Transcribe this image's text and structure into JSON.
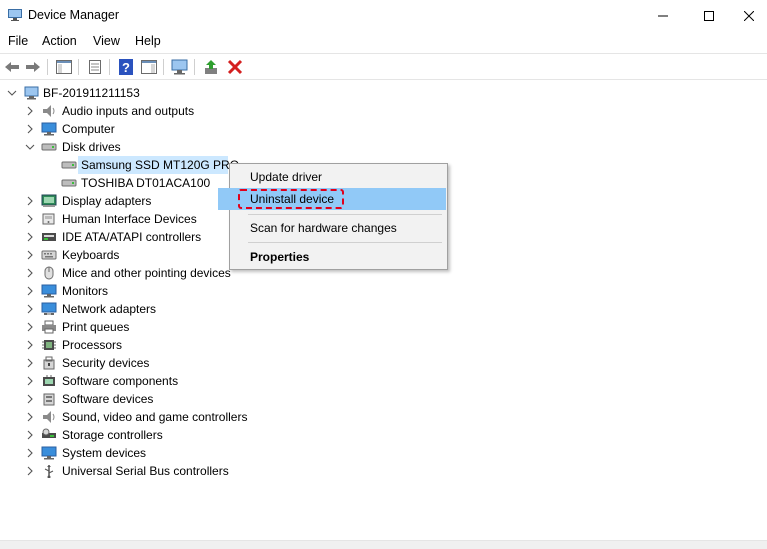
{
  "window": {
    "title": "Device Manager",
    "controls": {
      "minimize": "—",
      "maximize": "☐",
      "close": "✕"
    }
  },
  "menu": [
    "File",
    "Action",
    "View",
    "Help"
  ],
  "toolbar": {
    "buttons": [
      "back-icon",
      "forward-icon",
      "show-hide-console-tree-icon",
      "properties-icon",
      "help-icon",
      "show-action-pane-icon",
      "scan-hardware-icon",
      "update-driver-icon",
      "uninstall-icon"
    ]
  },
  "tree": {
    "root": "BF-201911211153",
    "categories": [
      {
        "label": "Audio inputs and outputs",
        "icon": "speaker-icon",
        "expanded": false
      },
      {
        "label": "Computer",
        "icon": "computer-icon",
        "expanded": false
      },
      {
        "label": "Disk drives",
        "icon": "disk-drive-icon",
        "expanded": true,
        "children": [
          "Samsung SSD MT120G PRO",
          "TOSHIBA DT01ACA100"
        ]
      },
      {
        "label": "Display adapters",
        "icon": "display-adapter-icon",
        "expanded": false
      },
      {
        "label": "Human Interface Devices",
        "icon": "hid-icon",
        "expanded": false
      },
      {
        "label": "IDE ATA/ATAPI controllers",
        "icon": "ide-controller-icon",
        "expanded": false
      },
      {
        "label": "Keyboards",
        "icon": "keyboard-icon",
        "expanded": false
      },
      {
        "label": "Mice and other pointing devices",
        "icon": "mouse-icon",
        "expanded": false
      },
      {
        "label": "Monitors",
        "icon": "monitor-icon",
        "expanded": false
      },
      {
        "label": "Network adapters",
        "icon": "network-adapter-icon",
        "expanded": false
      },
      {
        "label": "Print queues",
        "icon": "printer-icon",
        "expanded": false
      },
      {
        "label": "Processors",
        "icon": "processor-icon",
        "expanded": false
      },
      {
        "label": "Security devices",
        "icon": "security-device-icon",
        "expanded": false
      },
      {
        "label": "Software components",
        "icon": "software-component-icon",
        "expanded": false
      },
      {
        "label": "Software devices",
        "icon": "software-device-icon",
        "expanded": false
      },
      {
        "label": "Sound, video and game controllers",
        "icon": "sound-controller-icon",
        "expanded": false
      },
      {
        "label": "Storage controllers",
        "icon": "storage-controller-icon",
        "expanded": false
      },
      {
        "label": "System devices",
        "icon": "system-device-icon",
        "expanded": false
      },
      {
        "label": "Universal Serial Bus controllers",
        "icon": "usb-icon",
        "expanded": false
      }
    ]
  },
  "context_menu": {
    "items": [
      "Update driver",
      "Uninstall device",
      "Scan for hardware changes",
      "Properties"
    ],
    "highlighted": "Uninstall device"
  },
  "colors": {
    "selection": "#cce8ff",
    "menu_highlight": "#91c9f7",
    "annotation": "#e0001b",
    "uninstall_red": "#d41f1f"
  }
}
